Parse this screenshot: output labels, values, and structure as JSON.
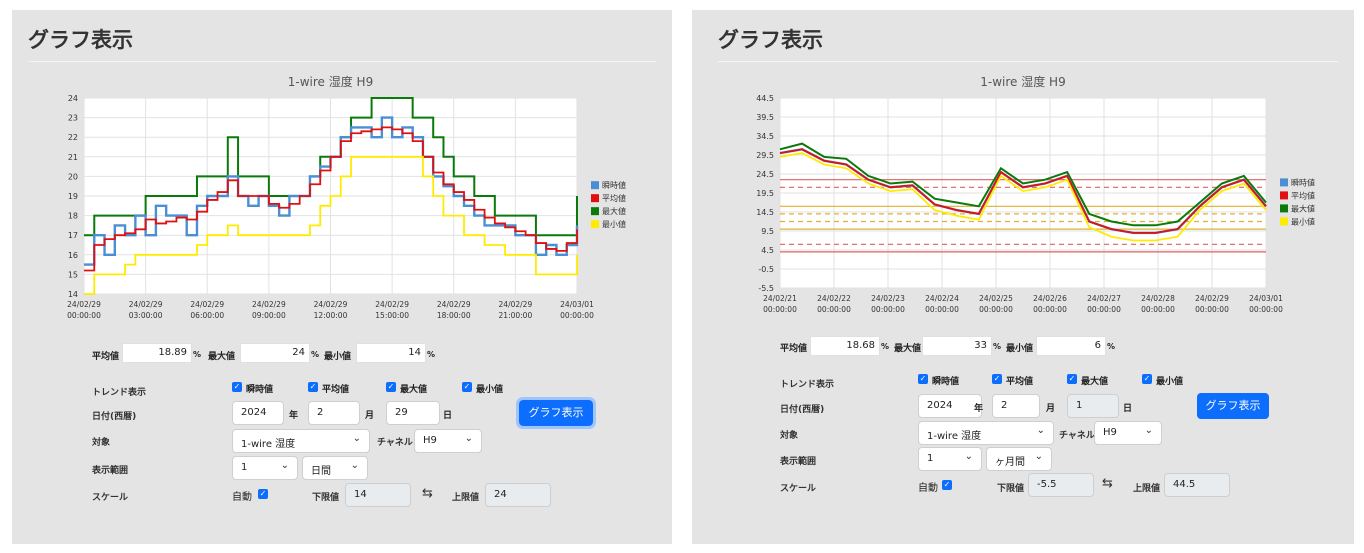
{
  "panels": [
    {
      "title": "グラフ表示",
      "chart_data": {
        "type": "line",
        "title": "1-wire 湿度 H9",
        "xlabel": "",
        "ylabel": "",
        "x_ticks": [
          [
            "24/02/29",
            "00:00:00"
          ],
          [
            "24/02/29",
            "03:00:00"
          ],
          [
            "24/02/29",
            "06:00:00"
          ],
          [
            "24/02/29",
            "09:00:00"
          ],
          [
            "24/02/29",
            "12:00:00"
          ],
          [
            "24/02/29",
            "15:00:00"
          ],
          [
            "24/02/29",
            "18:00:00"
          ],
          [
            "24/02/29",
            "21:00:00"
          ],
          [
            "24/03/01",
            "00:00:00"
          ]
        ],
        "y_ticks": [
          "24",
          "23",
          "22",
          "21",
          "20",
          "19",
          "18",
          "17",
          "16",
          "15",
          "14"
        ],
        "ylim": [
          14,
          24
        ],
        "grid": true,
        "legend_position": "right",
        "legend": [
          "瞬時値",
          "平均値",
          "最大値",
          "最小値"
        ],
        "x_hours": [
          0,
          0.5,
          1,
          1.5,
          2,
          2.5,
          3,
          3.5,
          4,
          4.5,
          5,
          5.5,
          6,
          6.5,
          7,
          7.5,
          8,
          8.5,
          9,
          9.5,
          10,
          10.5,
          11,
          11.5,
          12,
          12.5,
          13,
          13.5,
          14,
          14.5,
          15,
          15.5,
          16,
          16.5,
          17,
          17.5,
          18,
          18.5,
          19,
          19.5,
          20,
          20.5,
          21,
          21.5,
          22,
          22.5,
          23,
          23.5,
          24
        ],
        "series": [
          {
            "name": "最大値",
            "color": "#0a7a0a",
            "values": [
              17,
              18,
              18,
              18,
              18,
              18,
              19,
              19,
              19,
              19,
              19,
              20,
              20,
              20,
              22,
              20,
              20,
              20,
              19,
              19,
              19,
              19,
              20,
              21,
              21,
              22,
              23,
              23,
              24,
              24,
              24,
              24,
              23,
              23,
              22,
              21,
              20,
              20,
              19,
              19,
              18,
              18,
              18,
              18,
              17,
              17,
              17,
              17,
              19
            ]
          },
          {
            "name": "瞬時値",
            "color": "#4a8fd4",
            "values": [
              15.5,
              17,
              16,
              17.5,
              17,
              18,
              17,
              18.5,
              18,
              18,
              17,
              18.5,
              19,
              19,
              20,
              19,
              18.5,
              19,
              18.5,
              18,
              19,
              19,
              20,
              20.5,
              21,
              22,
              22.5,
              22.5,
              22,
              23,
              22,
              22.5,
              22,
              21,
              20,
              19.5,
              19,
              18.5,
              18,
              17.5,
              17.5,
              17.5,
              17,
              17,
              16,
              16.5,
              16,
              16.5,
              17.5
            ]
          },
          {
            "name": "平均値",
            "color": "#e01010",
            "values": [
              15.2,
              16.5,
              16.8,
              17,
              17.1,
              17.3,
              17.8,
              17.6,
              17.7,
              17.9,
              17.8,
              18.2,
              18.8,
              19.2,
              19.8,
              19,
              19,
              19,
              18.6,
              18.4,
              18.6,
              19,
              19.6,
              20.3,
              21,
              21.8,
              22.2,
              22.3,
              22.4,
              22.5,
              22.4,
              22.2,
              21.8,
              21,
              20.2,
              19.6,
              19.2,
              18.8,
              18.3,
              17.9,
              17.6,
              17.4,
              17.2,
              17,
              16.6,
              16.3,
              16.2,
              16.6,
              17.3
            ]
          },
          {
            "name": "最小値",
            "color": "#ffeb00",
            "values": [
              14,
              15,
              15,
              15,
              15.5,
              16,
              16,
              16,
              16,
              16,
              16,
              16.5,
              17,
              17,
              17.5,
              17,
              17,
              17,
              17,
              17,
              17,
              17,
              17.5,
              18.5,
              19,
              20,
              21,
              21,
              21,
              21,
              21,
              21,
              21,
              20,
              19,
              18,
              18,
              17,
              17,
              16.5,
              16.5,
              16,
              16,
              16,
              15,
              15,
              15,
              15,
              16
            ]
          }
        ]
      },
      "stats": {
        "avg_label": "平均値",
        "avg": "18.89",
        "max_label": "最大値",
        "max": "24",
        "min_label": "最小値",
        "min": "14",
        "unit": "%"
      },
      "form": {
        "trend_label": "トレンド表示",
        "cb1": "瞬時値",
        "cb2": "平均値",
        "cb3": "最大値",
        "cb4": "最小値",
        "date_label": "日付(西暦)",
        "year": "2024",
        "year_unit": "年",
        "month": "2",
        "month_unit": "月",
        "day": "29",
        "day_unit": "日",
        "button": "グラフ表示",
        "target_label": "対象",
        "target": "1-wire 湿度",
        "channel_label": "チャネル",
        "channel": "H9",
        "range_label": "表示範囲",
        "range_num": "1",
        "range_unit": "日間",
        "scale_label": "スケール",
        "auto_label": "自動",
        "lower_label": "下限値",
        "lower": "14",
        "swap": "⇆",
        "upper_label": "上限値",
        "upper": "24"
      }
    },
    {
      "title": "グラフ表示",
      "chart_data": {
        "type": "line",
        "title": "1-wire 湿度 H9",
        "xlabel": "",
        "ylabel": "",
        "x_ticks": [
          [
            "24/02/21",
            "00:00:00"
          ],
          [
            "24/02/22",
            "00:00:00"
          ],
          [
            "24/02/23",
            "00:00:00"
          ],
          [
            "24/02/24",
            "00:00:00"
          ],
          [
            "24/02/25",
            "00:00:00"
          ],
          [
            "24/02/26",
            "00:00:00"
          ],
          [
            "24/02/27",
            "00:00:00"
          ],
          [
            "24/02/28",
            "00:00:00"
          ],
          [
            "24/02/29",
            "00:00:00"
          ],
          [
            "24/03/01",
            "00:00:00"
          ]
        ],
        "y_ticks": [
          "44.5",
          "39.5",
          "34.5",
          "29.5",
          "24.5",
          "19.5",
          "14.5",
          "9.5",
          "4.5",
          "-0.5",
          "-5.5"
        ],
        "ylim": [
          -5.5,
          44.5
        ],
        "grid": true,
        "legend_position": "right",
        "legend": [
          "瞬時値",
          "平均値",
          "最大値",
          "最小値"
        ],
        "x_days": [
          0,
          0.5,
          1,
          1.5,
          2,
          2.5,
          3,
          3.5,
          4,
          4.5,
          5,
          5.5,
          6,
          6.5,
          7,
          7.5,
          8,
          8.5,
          9,
          9.5
        ],
        "series": [
          {
            "name": "最大値",
            "color": "#0a7a0a",
            "values": [
              31,
              32.5,
              29,
              28.5,
              24,
              22,
              22.5,
              18,
              17,
              16,
              26,
              22,
              23,
              25,
              14,
              12,
              11,
              11,
              12,
              17,
              22,
              24,
              17
            ]
          },
          {
            "name": "瞬時値",
            "color": "#4a8fd4",
            "values": [
              30,
              31,
              28,
              27,
              23,
              21,
              21.5,
              16.5,
              15,
              14,
              25,
              21,
              22,
              24,
              12,
              10,
              9,
              9,
              10,
              16,
              21,
              23,
              16
            ]
          },
          {
            "name": "平均値",
            "color": "#e01010",
            "values": [
              30,
              31,
              28,
              27,
              23,
              21,
              21.5,
              16.5,
              15,
              14,
              25,
              21,
              22,
              24,
              12,
              10,
              9,
              9,
              10,
              16,
              21,
              23,
              16
            ]
          },
          {
            "name": "最小値",
            "color": "#ffeb00",
            "values": [
              29,
              30,
              27,
              26,
              22,
              20,
              20.5,
              15,
              13.5,
              12.5,
              24,
              20,
              21,
              23,
              10.5,
              8,
              7,
              7,
              8,
              15,
              20,
              22,
              15
            ]
          }
        ],
        "reference_lines": [
          {
            "value": 23,
            "color": "#e06060",
            "style": "solid"
          },
          {
            "value": 21,
            "color": "#e06060",
            "style": "dashed"
          },
          {
            "value": 16,
            "color": "#e0b030",
            "style": "solid"
          },
          {
            "value": 14,
            "color": "#e0b030",
            "style": "dashed"
          },
          {
            "value": 12,
            "color": "#e0b030",
            "style": "dashed"
          },
          {
            "value": 10,
            "color": "#e0b030",
            "style": "solid"
          },
          {
            "value": 6,
            "color": "#e06060",
            "style": "dashed"
          },
          {
            "value": 4,
            "color": "#e06060",
            "style": "solid"
          }
        ]
      },
      "stats": {
        "avg_label": "平均値",
        "avg": "18.68",
        "max_label": "最大値",
        "max": "33",
        "min_label": "最小値",
        "min": "6",
        "unit": "%"
      },
      "form": {
        "trend_label": "トレンド表示",
        "cb1": "瞬時値",
        "cb2": "平均値",
        "cb3": "最大値",
        "cb4": "最小値",
        "date_label": "日付(西暦)",
        "year": "2024",
        "year_unit": "年",
        "month": "2",
        "month_unit": "月",
        "day": "1",
        "day_unit": "日",
        "button": "グラフ表示",
        "target_label": "対象",
        "target": "1-wire 湿度",
        "channel_label": "チャネル",
        "channel": "H9",
        "range_label": "表示範囲",
        "range_num": "1",
        "range_unit": "ヶ月間",
        "scale_label": "スケール",
        "auto_label": "自動",
        "lower_label": "下限値",
        "lower": "-5.5",
        "swap": "⇆",
        "upper_label": "上限値",
        "upper": "44.5"
      }
    }
  ]
}
